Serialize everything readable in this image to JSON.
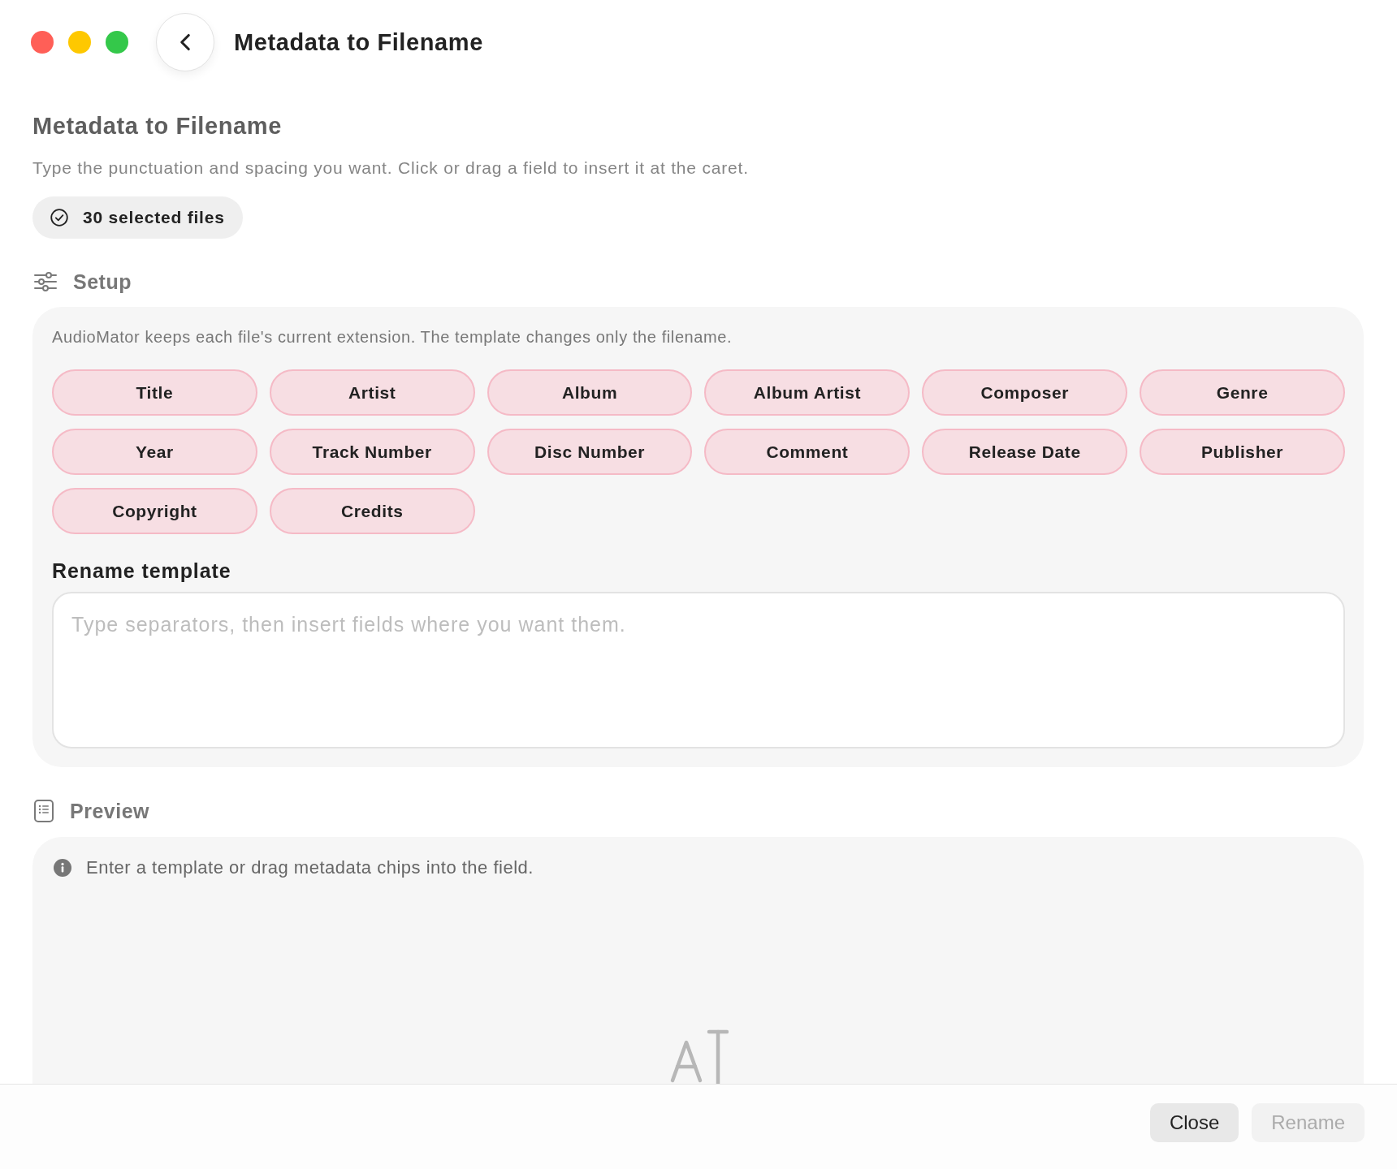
{
  "window": {
    "title": "Metadata to Filename"
  },
  "header": {
    "title": "Metadata to Filename",
    "description": "Type the punctuation and spacing you want. Click or drag a field to insert it at the caret.",
    "selection_badge": "30 selected files"
  },
  "setup": {
    "heading": "Setup",
    "note": "AudioMator keeps each file's current extension. The template changes only the filename.",
    "chips": [
      "Title",
      "Artist",
      "Album",
      "Album Artist",
      "Composer",
      "Genre",
      "Year",
      "Track Number",
      "Disc Number",
      "Comment",
      "Release Date",
      "Publisher",
      "Copyright",
      "Credits"
    ],
    "template": {
      "label": "Rename template",
      "placeholder": "Type separators, then insert fields where you want them."
    }
  },
  "preview": {
    "heading": "Preview",
    "message": "Enter a template or drag metadata chips into the field."
  },
  "buttons": [
    {
      "label": "Close",
      "disabled": false
    },
    {
      "label": "Rename",
      "disabled": true
    }
  ]
}
